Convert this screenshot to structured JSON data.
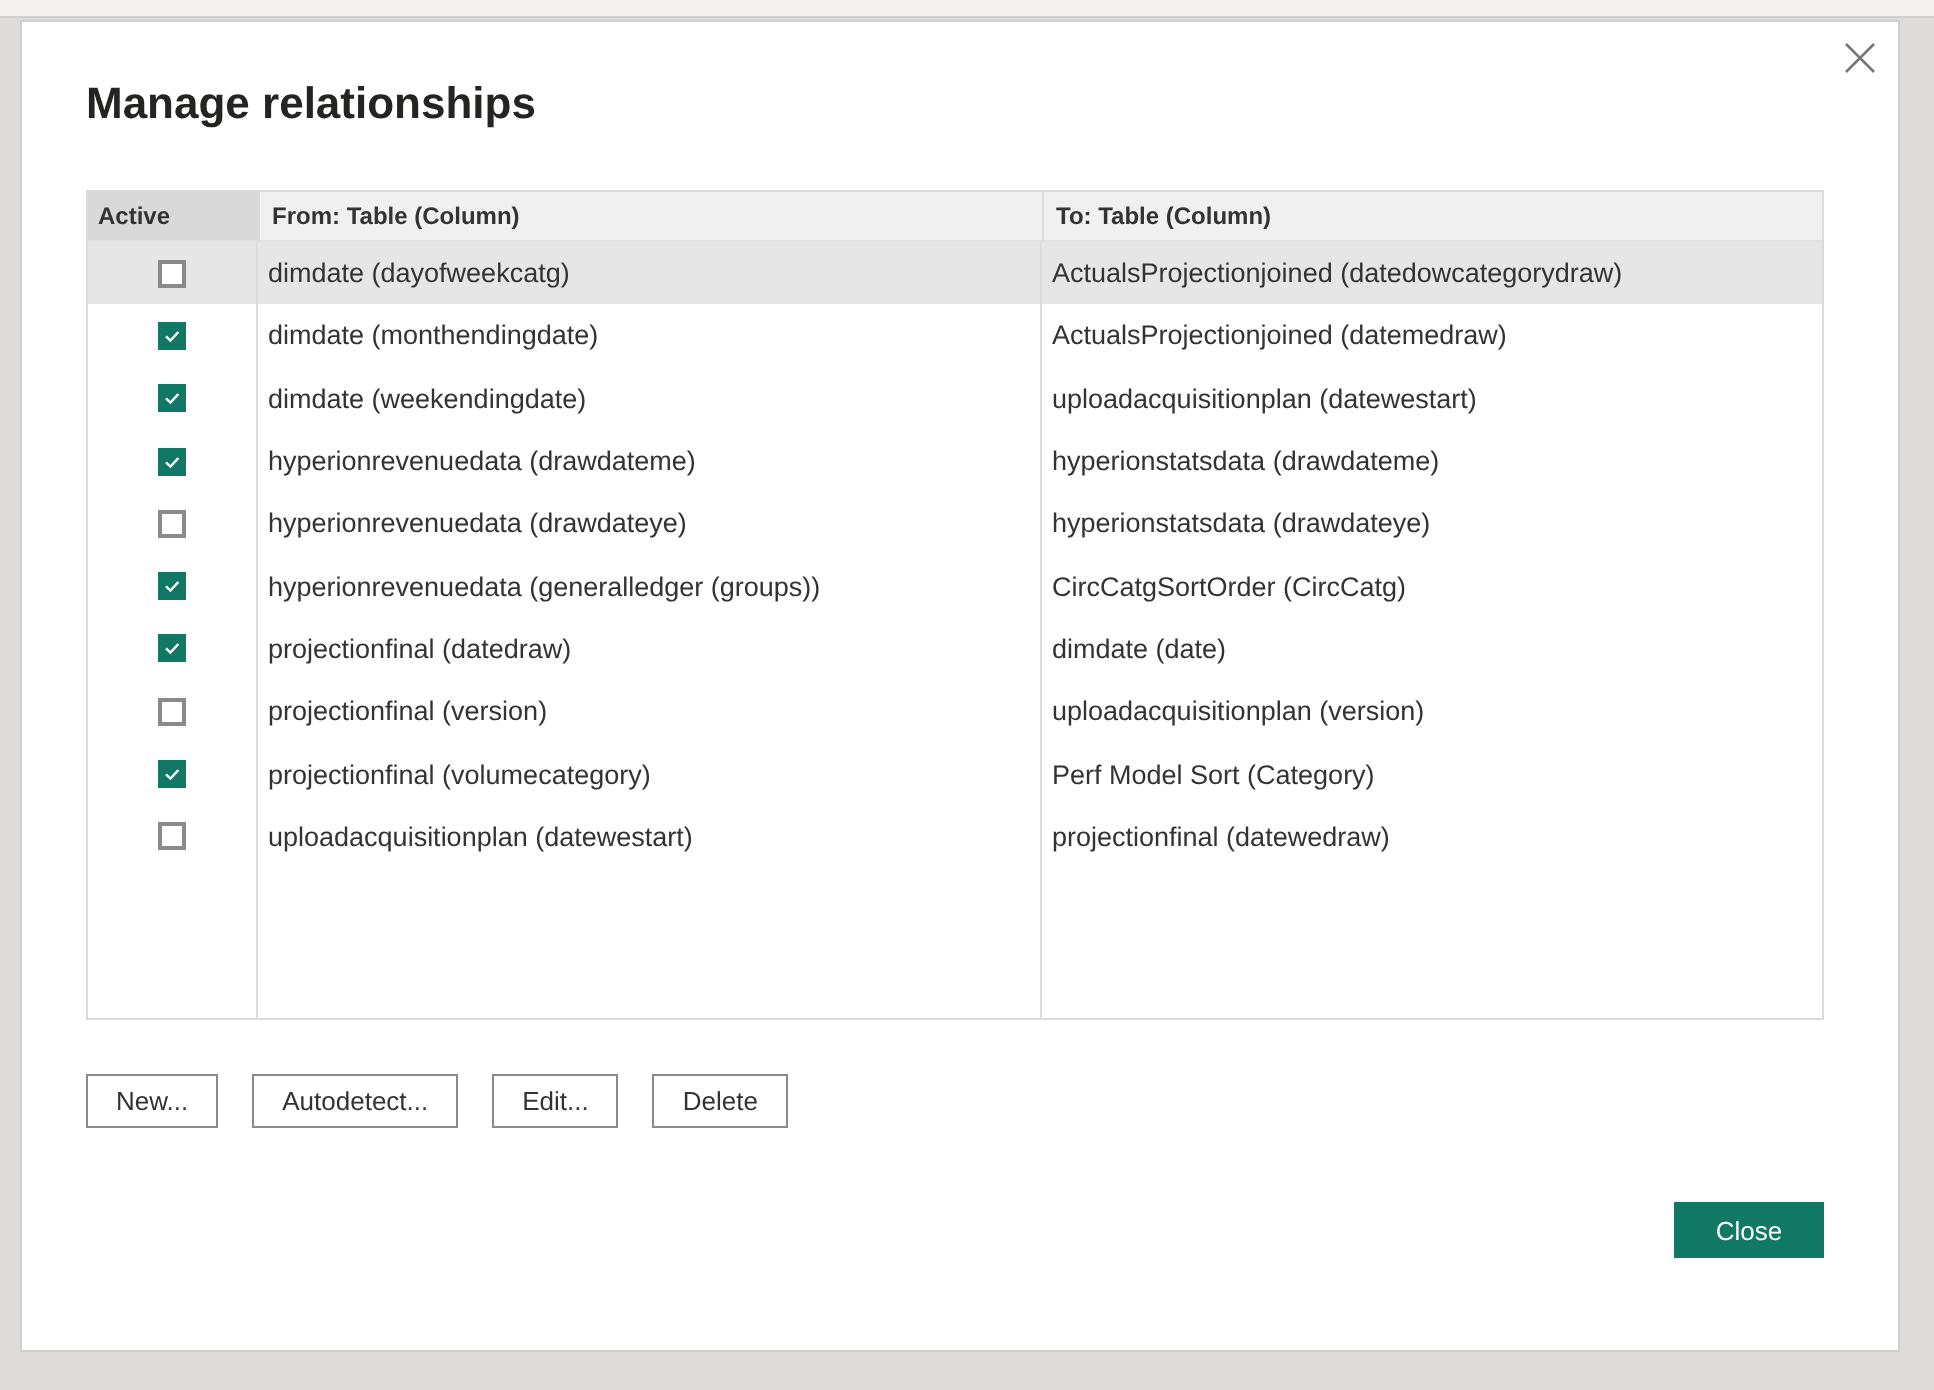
{
  "dialog": {
    "title": "Manage relationships"
  },
  "table": {
    "columns": [
      "Active",
      "From: Table (Column)",
      "To: Table (Column)"
    ],
    "rows": [
      {
        "active": false,
        "from": "dimdate (dayofweekcatg)",
        "to": "ActualsProjectionjoined (datedowcategorydraw)",
        "selected": true
      },
      {
        "active": true,
        "from": "dimdate (monthendingdate)",
        "to": "ActualsProjectionjoined (datemedraw)",
        "selected": false
      },
      {
        "active": true,
        "from": "dimdate (weekendingdate)",
        "to": "uploadacquisitionplan (datewestart)",
        "selected": false
      },
      {
        "active": true,
        "from": "hyperionrevenuedata (drawdateme)",
        "to": "hyperionstatsdata (drawdateme)",
        "selected": false
      },
      {
        "active": false,
        "from": "hyperionrevenuedata (drawdateye)",
        "to": "hyperionstatsdata (drawdateye)",
        "selected": false
      },
      {
        "active": true,
        "from": "hyperionrevenuedata (generalledger (groups))",
        "to": "CircCatgSortOrder (CircCatg)",
        "selected": false
      },
      {
        "active": true,
        "from": "projectionfinal (datedraw)",
        "to": "dimdate (date)",
        "selected": false
      },
      {
        "active": false,
        "from": "projectionfinal (version)",
        "to": "uploadacquisitionplan (version)",
        "selected": false
      },
      {
        "active": true,
        "from": "projectionfinal (volumecategory)",
        "to": "Perf Model Sort (Category)",
        "selected": false
      },
      {
        "active": false,
        "from": "uploadacquisitionplan (datewestart)",
        "to": "projectionfinal (datewedraw)",
        "selected": false
      }
    ]
  },
  "actions": [
    "New...",
    "Autodetect...",
    "Edit...",
    "Delete"
  ],
  "close_button": "Close"
}
